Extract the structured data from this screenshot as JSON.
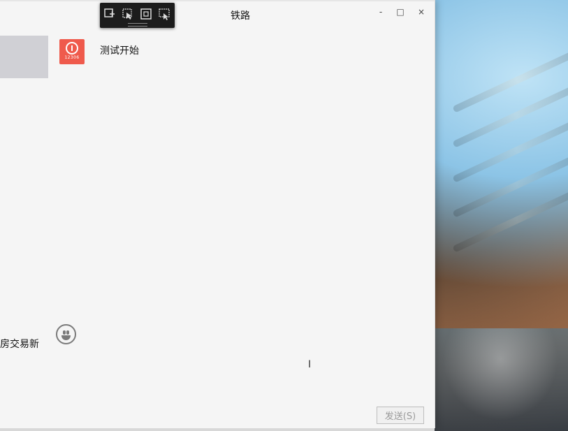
{
  "window": {
    "title": "铁路"
  },
  "window_controls": {
    "minimize": "-",
    "maximize": "□",
    "close": "×"
  },
  "snip_toolbar": {
    "tools": [
      "new-snip-icon",
      "freeform-icon",
      "rectangle-icon",
      "window-snip-icon"
    ]
  },
  "chat": {
    "name": "测试开始",
    "avatar_text": "12306"
  },
  "input": {
    "text": "房交易新",
    "emoji": "smiley-icon"
  },
  "actions": {
    "send_label": "发送(S)"
  },
  "colors": {
    "avatar_bg": "#ef5a4c",
    "window_bg": "#f5f5f5",
    "toolbar_bg": "#1c1c1c"
  }
}
